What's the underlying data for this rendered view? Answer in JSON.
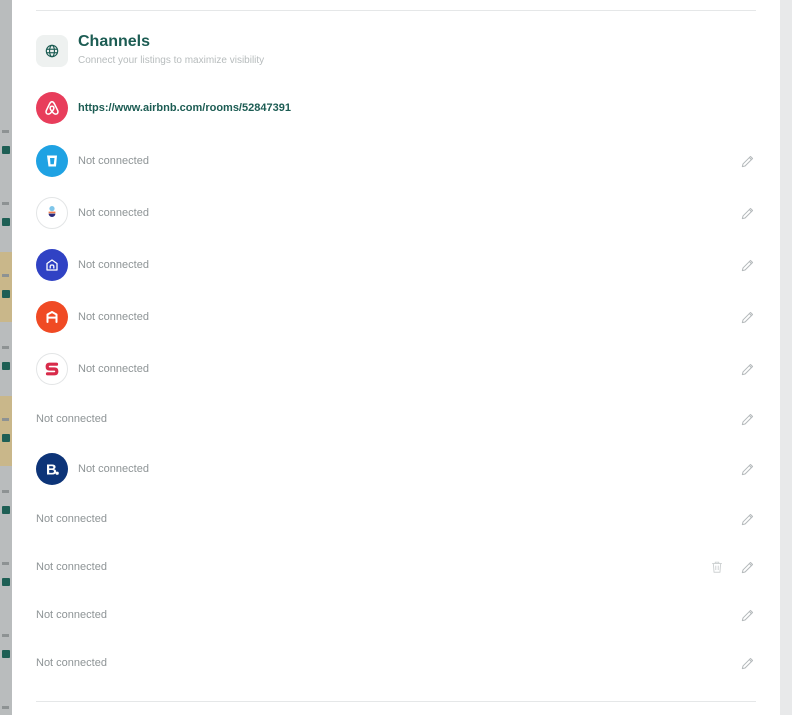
{
  "channels": {
    "title": "Channels",
    "subtitle": "Connect your listings to maximize visibility",
    "header_icon": "globe-icon",
    "items": [
      {
        "logo": "airbnb-logo",
        "logo_color": "#e83d5b",
        "text": "https://www.airbnb.com/rooms/52847391",
        "connected": true
      },
      {
        "logo": "vrbo-logo",
        "logo_color": "#1fa2e3",
        "text": "Not connected",
        "connected": false
      },
      {
        "logo": "plum-guide-logo",
        "logo_color": "#ffffff",
        "text": "Not connected",
        "connected": false
      },
      {
        "logo": "home-logo",
        "logo_color": "#3042c4",
        "text": "Not connected",
        "connected": false
      },
      {
        "logo": "hometogo-logo",
        "logo_color": "#f04a24",
        "text": "Not connected",
        "connected": false
      },
      {
        "logo": "s-logo",
        "logo_color": "#ffffff",
        "text": "Not connected",
        "connected": false
      },
      {
        "logo": "",
        "text": "Not connected",
        "connected": false
      },
      {
        "logo": "booking-logo",
        "logo_color": "#0d3478",
        "text": "Not connected",
        "connected": false
      },
      {
        "logo": "",
        "text": "Not connected",
        "connected": false
      },
      {
        "logo": "",
        "text": "Not connected",
        "connected": false,
        "deletable": true
      },
      {
        "logo": "",
        "text": "Not connected",
        "connected": false
      },
      {
        "logo": "",
        "text": "Not connected",
        "connected": false
      }
    ]
  },
  "colors": {
    "accent": "#1c5c53",
    "muted_text": "#8e9496",
    "icon_gray": "#b4b9bb"
  }
}
